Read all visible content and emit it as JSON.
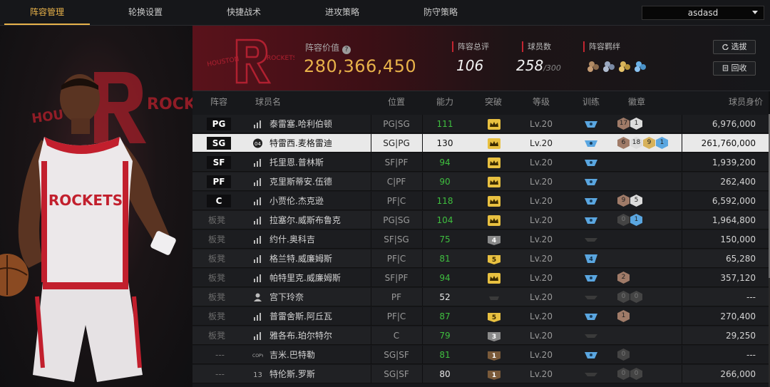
{
  "nav": {
    "tabs": [
      "阵容管理",
      "轮换设置",
      "快捷战术",
      "进攻策略",
      "防守策略"
    ],
    "active_index": 0,
    "lineup_select": "asdasd"
  },
  "team": {
    "logo_text_left": "HOUSTON",
    "logo_text_right": "ROCKETS",
    "value_label": "阵容价值",
    "value": "280,366,450",
    "rating_label": "阵容总评",
    "rating": "106",
    "player_count_label": "球员数",
    "player_count": "258",
    "player_count_max": "/300",
    "chemistry_label": "阵容羁绊",
    "filter_button": "选拔",
    "recycle_button": "回收"
  },
  "hero": {
    "jersey_text": "ROCKETS"
  },
  "table": {
    "headers": [
      "阵容",
      "球员名",
      "位置",
      "能力",
      "突破",
      "等级",
      "训练",
      "徽章",
      "球员身价"
    ],
    "rows": [
      {
        "slot": "PG",
        "slot_type": "starter",
        "icon": "stats",
        "name": "泰雷塞.哈利伯顿",
        "position": "PG|SG",
        "ability": "111",
        "ability_color": "green",
        "break": "crown",
        "level": "Lv.20",
        "train": "blue",
        "badges": [
          {
            "t": "bronze",
            "v": "17"
          },
          {
            "t": "silver",
            "v": "1"
          }
        ],
        "worth": "6,976,000"
      },
      {
        "slot": "SG",
        "slot_type": "starter",
        "icon": "04",
        "name": "特雷西.麦格雷迪",
        "position": "SG|PG",
        "ability": "130",
        "ability_color": "white",
        "break": "crown",
        "level": "Lv.20",
        "train": "blue",
        "badges": [
          {
            "t": "bronze",
            "v": "6"
          },
          {
            "t": "silver",
            "v": "18"
          },
          {
            "t": "gold",
            "v": "9"
          },
          {
            "t": "blue",
            "v": "1"
          }
        ],
        "worth": "261,760,000",
        "selected": true
      },
      {
        "slot": "SF",
        "slot_type": "starter",
        "icon": "stats",
        "name": "托里恩.普林斯",
        "position": "SF|PF",
        "ability": "94",
        "ability_color": "green",
        "break": "crown",
        "level": "Lv.20",
        "train": "blue",
        "badges": [],
        "worth": "1,939,200"
      },
      {
        "slot": "PF",
        "slot_type": "starter",
        "icon": "stats",
        "name": "克里斯蒂安.伍德",
        "position": "C|PF",
        "ability": "90",
        "ability_color": "green",
        "break": "crown",
        "level": "Lv.20",
        "train": "blue",
        "badges": [],
        "worth": "262,400"
      },
      {
        "slot": "C",
        "slot_type": "starter",
        "icon": "stats",
        "name": "小贾伦.杰克逊",
        "position": "PF|C",
        "ability": "118",
        "ability_color": "green",
        "break": "crown",
        "level": "Lv.20",
        "train": "blue",
        "badges": [
          {
            "t": "bronze",
            "v": "9"
          },
          {
            "t": "silver",
            "v": "5"
          }
        ],
        "worth": "6,592,000"
      },
      {
        "slot": "板凳",
        "slot_type": "bench",
        "icon": "stats",
        "name": "拉塞尔.威斯布鲁克",
        "position": "PG|SG",
        "ability": "104",
        "ability_color": "green",
        "break": "crown",
        "level": "Lv.20",
        "train": "blue",
        "badges": [
          {
            "t": "dark",
            "v": "0"
          },
          {
            "t": "blue",
            "v": "1"
          }
        ],
        "worth": "1,964,800"
      },
      {
        "slot": "板凳",
        "slot_type": "bench",
        "icon": "stats",
        "name": "约什.奥科吉",
        "position": "SF|SG",
        "ability": "75",
        "ability_color": "green",
        "break": "4",
        "level": "Lv.20",
        "train": "gray",
        "badges": [],
        "worth": "150,000"
      },
      {
        "slot": "板凳",
        "slot_type": "bench",
        "icon": "stats",
        "name": "格兰特.威廉姆斯",
        "position": "PF|C",
        "ability": "81",
        "ability_color": "green",
        "break": "5",
        "level": "Lv.20",
        "train": "4",
        "badges": [],
        "worth": "65,280"
      },
      {
        "slot": "板凳",
        "slot_type": "bench",
        "icon": "stats",
        "name": "帕特里克.威廉姆斯",
        "position": "SF|PF",
        "ability": "94",
        "ability_color": "green",
        "break": "crown",
        "level": "Lv.20",
        "train": "blue",
        "badges": [
          {
            "t": "bronze",
            "v": "2"
          }
        ],
        "worth": "357,120"
      },
      {
        "slot": "板凳",
        "slot_type": "bench",
        "icon": "person",
        "name": "宫下玲奈",
        "position": "PF",
        "ability": "52",
        "ability_color": "white",
        "break": "none",
        "level": "Lv.20",
        "train": "gray",
        "badges": [
          {
            "t": "dark",
            "v": "0"
          },
          {
            "t": "dark",
            "v": "0"
          }
        ],
        "worth": "---"
      },
      {
        "slot": "板凳",
        "slot_type": "bench",
        "icon": "stats",
        "name": "普雷舍斯.阿丘瓦",
        "position": "PF|C",
        "ability": "87",
        "ability_color": "green",
        "break": "5",
        "level": "Lv.20",
        "train": "blue",
        "badges": [
          {
            "t": "bronze",
            "v": "1"
          }
        ],
        "worth": "270,400"
      },
      {
        "slot": "板凳",
        "slot_type": "bench",
        "icon": "stats",
        "name": "雅各布.珀尔特尔",
        "position": "C",
        "ability": "79",
        "ability_color": "green",
        "break": "3",
        "level": "Lv.20",
        "train": "gray",
        "badges": [],
        "worth": "29,250"
      },
      {
        "slot": "---",
        "slot_type": "none",
        "icon": "COPY",
        "name": "吉米.巴特勒",
        "position": "SG|SF",
        "ability": "81",
        "ability_color": "green",
        "break": "1",
        "level": "Lv.20",
        "train": "blue",
        "badges": [
          {
            "t": "dark",
            "v": "0"
          }
        ],
        "worth": "---"
      },
      {
        "slot": "---",
        "slot_type": "none",
        "icon": "13",
        "name": "特伦斯.罗斯",
        "position": "SG|SF",
        "ability": "80",
        "ability_color": "white",
        "break": "1",
        "level": "Lv.20",
        "train": "gray",
        "badges": [
          {
            "t": "dark",
            "v": "0"
          },
          {
            "t": "dark",
            "v": "0"
          }
        ],
        "worth": "266,000"
      }
    ]
  },
  "colors": {
    "accent": "#e8b24a",
    "team_red": "#c22530",
    "ability_green": "#3fbf3f"
  }
}
